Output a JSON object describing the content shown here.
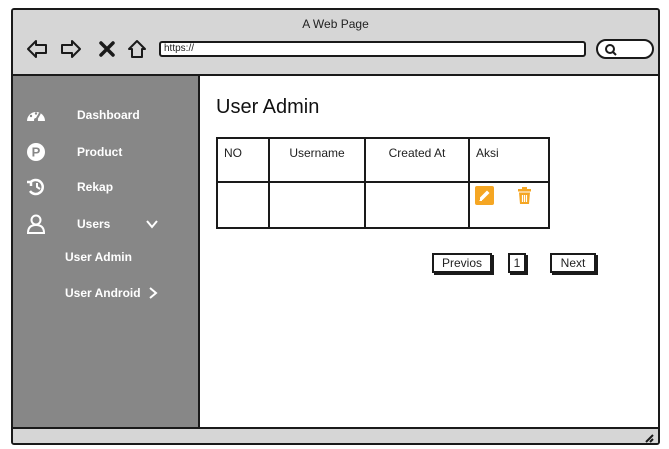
{
  "window": {
    "title": "A Web Page"
  },
  "browser": {
    "url": "https://"
  },
  "sidebar": {
    "items": [
      {
        "label": "Dashboard",
        "icon": "dashboard-gauge-icon"
      },
      {
        "label": "Product",
        "icon": "product-p-icon"
      },
      {
        "label": "Rekap",
        "icon": "history-icon"
      },
      {
        "label": "Users",
        "icon": "user-icon"
      }
    ],
    "submenu": [
      {
        "label": "User Admin"
      },
      {
        "label": "User Android"
      }
    ]
  },
  "main": {
    "title": "User Admin",
    "table": {
      "columns": [
        "NO",
        "Username",
        "Created At",
        "Aksi"
      ],
      "rows": [
        {
          "no": "",
          "username": "",
          "created_at": "",
          "actions": [
            "edit-icon",
            "trash-icon"
          ]
        }
      ]
    },
    "pagination": {
      "prev": "Previos",
      "page": "1",
      "next": "Next"
    }
  },
  "colors": {
    "sidebar": "#878787",
    "chrome": "#d6d6d6",
    "accent": "#f5a623"
  }
}
